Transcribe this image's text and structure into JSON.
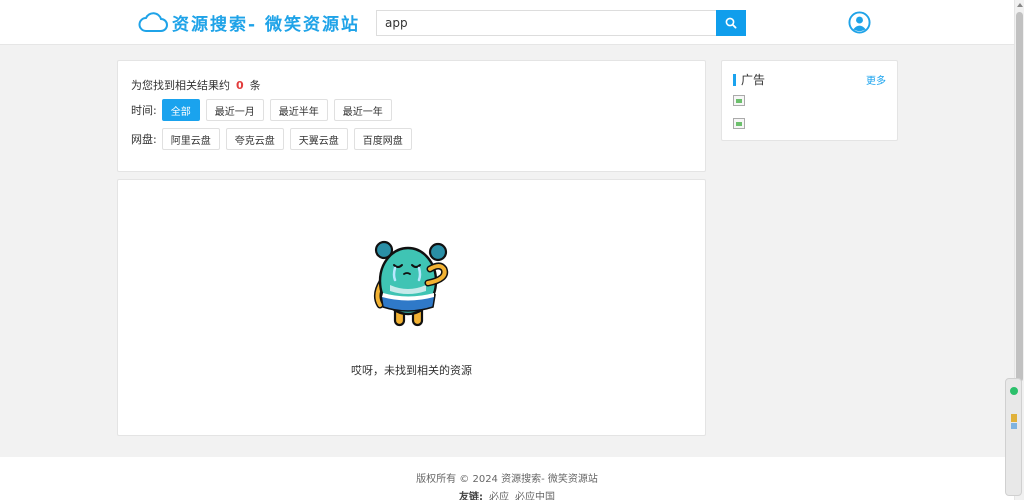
{
  "header": {
    "logo_text": "资源搜索- 微笑资源站",
    "search_value": "app",
    "brand_color": "#1fa3e8"
  },
  "filters": {
    "result_prefix": "为您找到相关结果约",
    "result_count": "0",
    "result_suffix": "条",
    "time_label": "时间:",
    "time_options": [
      "全部",
      "最近一月",
      "最近半年",
      "最近一年"
    ],
    "time_selected": "全部",
    "disk_label": "网盘:",
    "disk_options": [
      "阿里云盘",
      "夸克云盘",
      "天翼云盘",
      "百度网盘"
    ]
  },
  "results": {
    "empty_message": "哎呀，未找到相关的资源"
  },
  "sidebar": {
    "ad_title": "广告",
    "ad_more": "更多"
  },
  "footer": {
    "copyright": "版权所有 © 2024 资源搜索- 微笑资源站",
    "links_label": "友链:",
    "links": [
      "必应",
      "必应中国"
    ]
  },
  "icons": {
    "logo": "cloud-icon",
    "search": "search-icon",
    "user": "user-avatar-icon"
  }
}
